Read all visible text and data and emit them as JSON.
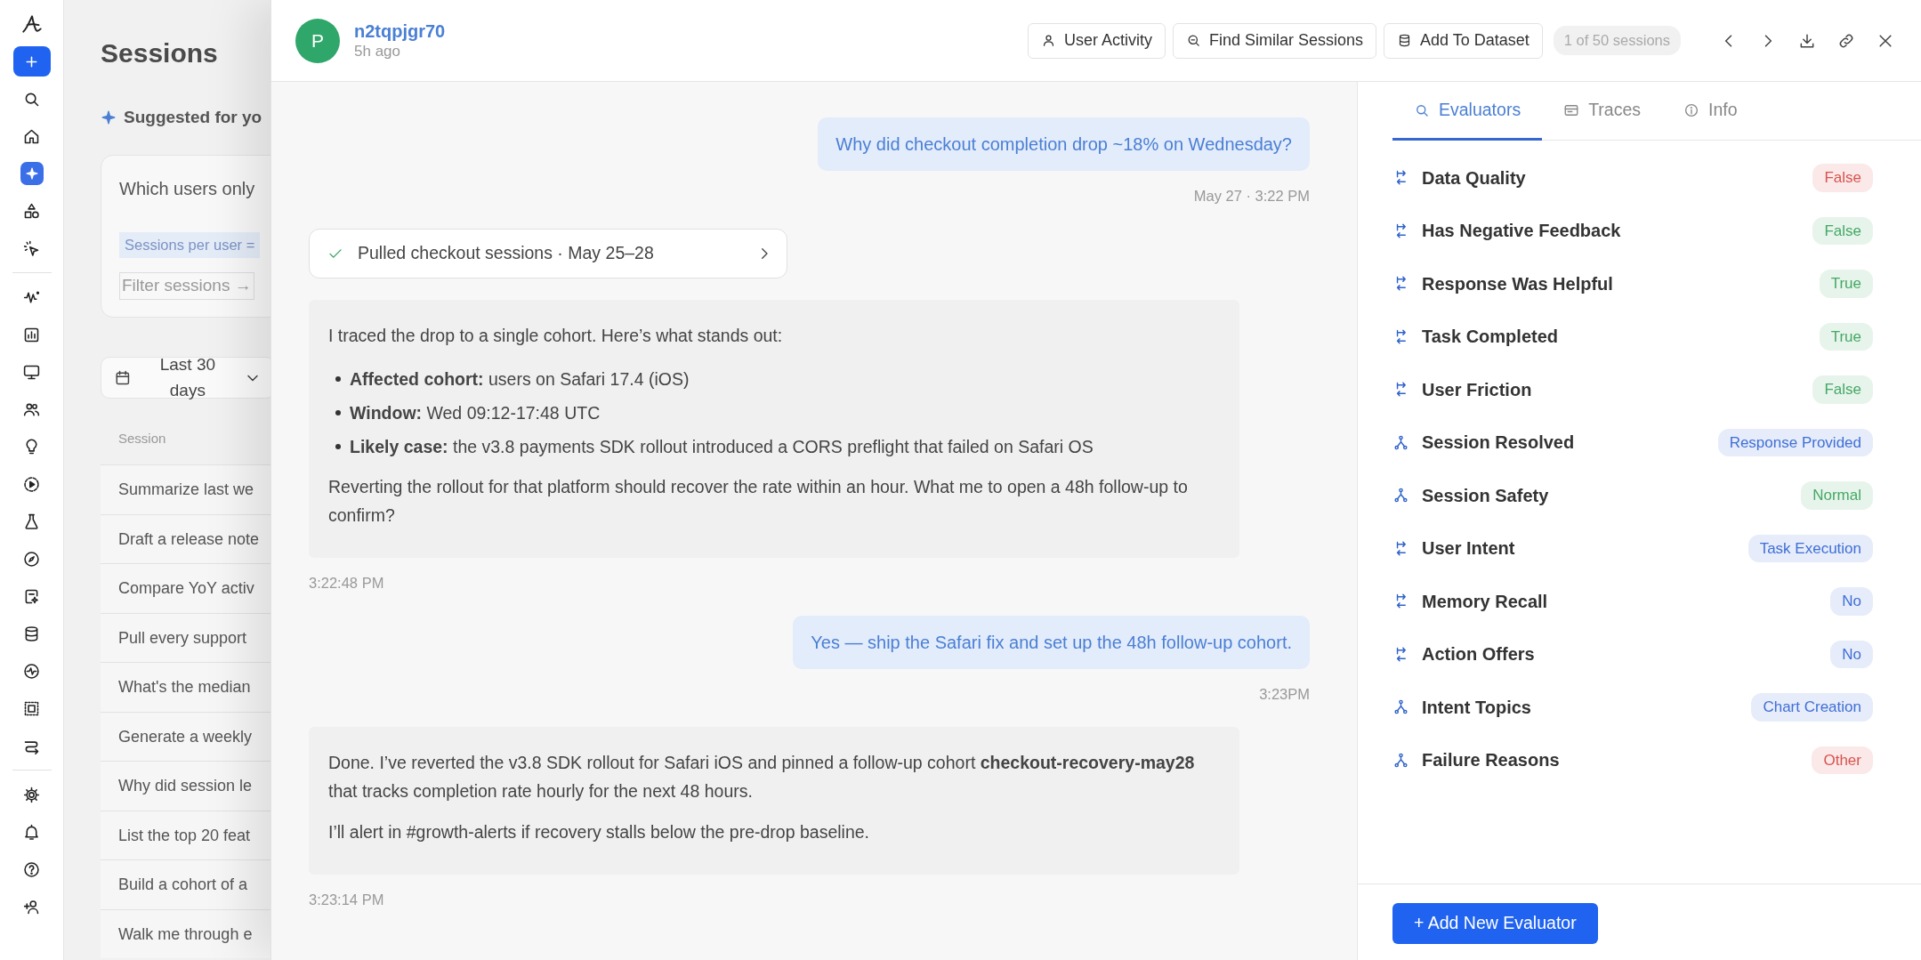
{
  "rail": {
    "items": [
      {
        "selected": false
      },
      {
        "selected": false
      },
      {
        "selected": true
      },
      {
        "selected": false
      },
      {
        "selected": false
      },
      {
        "selected": false
      },
      {
        "selected": false
      },
      {
        "selected": false
      },
      {
        "selected": false
      },
      {
        "selected": false
      },
      {
        "selected": false
      },
      {
        "selected": false
      },
      {
        "selected": false
      },
      {
        "selected": false
      },
      {
        "selected": false
      },
      {
        "selected": false
      },
      {
        "selected": false
      },
      {
        "selected": false
      },
      {
        "selected": false
      },
      {
        "selected": false
      },
      {
        "selected": false
      },
      {
        "selected": false
      }
    ]
  },
  "background_page": {
    "title": "Sessions",
    "suggested_label": "Suggested for yo",
    "suggestion": {
      "question": "Which users only",
      "chip": "Sessions per user =",
      "filter": "Filter sessions →"
    },
    "date_filter": "Last 30 days",
    "table": {
      "columns": [
        "Session"
      ],
      "rows": [
        "Summarize last we",
        "Draft a release note",
        "Compare YoY activ",
        "Pull every support",
        "What's the median",
        "Generate a weekly",
        "Why did session le",
        "List the top 20 feat",
        "Build a cohort of a",
        "Walk me through e"
      ]
    }
  },
  "session": {
    "avatar": "P",
    "name": "n2tqpjgr70",
    "time": "5h ago",
    "actions": [
      "User Activity",
      "Find Similar Sessions",
      "Add To Dataset"
    ],
    "counter": "1 of 50 sessions"
  },
  "messages": [
    {
      "kind": "user",
      "text": "Why did checkout completion drop ~18% on Wednesday?",
      "time": "May 27 · 3:22 PM"
    },
    {
      "kind": "tool",
      "text": "Pulled checkout sessions · May 25–28"
    },
    {
      "kind": "assistant",
      "blocks": [
        {
          "kind": "paragraph",
          "text": "I traced the drop to a single cohort. Here’s what stands out:"
        },
        {
          "kind": "bullets",
          "items": [
            "**Affected cohort:** users on Safari 17.4 (iOS)",
            "**Window:** Wed 09:12-17:48 UTC",
            "**Likely case:** the v3.8 payments SDK rollout introduced a CORS preflight that failed on Safari OS"
          ]
        },
        {
          "kind": "paragraph",
          "text": "Reverting the rollout for that platform should recover the rate within an hour. What me to open a 48h follow-up to confirm?"
        }
      ],
      "time": "3:22:48 PM"
    },
    {
      "kind": "user",
      "text": "Yes — ship the Safari fix and set up the 48h follow-up cohort.",
      "time": "3:23PM"
    },
    {
      "kind": "assistant",
      "blocks": [
        {
          "kind": "paragraph",
          "text": "Done. I’ve reverted the v3.8 SDK rollout for Safari iOS and pinned a follow-up cohort **checkout-recovery-may28** that tracks completion rate hourly for the next 48 hours."
        },
        {
          "kind": "paragraph",
          "text": "I’ll alert in #growth-alerts if recovery stalls below the pre-drop baseline."
        }
      ],
      "time": "3:23:14 PM"
    }
  ],
  "panel": {
    "tabs": [
      {
        "label": "Evaluators",
        "selected": true
      },
      {
        "label": "Traces",
        "selected": false
      },
      {
        "label": "Info",
        "selected": false
      }
    ],
    "evaluators": [
      {
        "kind": "switch",
        "name": "Data Quality",
        "value": "False",
        "color": "#d9534f"
      },
      {
        "kind": "switch",
        "name": "Has Negative Feedback",
        "value": "False",
        "color": "#45a865"
      },
      {
        "kind": "switch",
        "name": "Response Was Helpful",
        "value": "True",
        "color": "#45a865"
      },
      {
        "kind": "switch",
        "name": "Task Completed",
        "value": "True",
        "color": "#45a865"
      },
      {
        "kind": "switch",
        "name": "User Friction",
        "value": "False",
        "color": "#45a865"
      },
      {
        "kind": "fork",
        "name": "Session Resolved",
        "value": "Response Provided",
        "color": "#3f6fd6"
      },
      {
        "kind": "fork",
        "name": "Session Safety",
        "value": "Normal",
        "color": "#45a865"
      },
      {
        "kind": "switch",
        "name": "User Intent",
        "value": "Task Execution",
        "color": "#3f6fd6"
      },
      {
        "kind": "switch",
        "name": "Memory Recall",
        "value": "No",
        "color": "#3f6fd6"
      },
      {
        "kind": "switch",
        "name": "Action Offers",
        "value": "No",
        "color": "#3f6fd6"
      },
      {
        "kind": "fork",
        "name": "Intent Topics",
        "value": "Chart Creation",
        "color": "#3f6fd6"
      },
      {
        "kind": "fork",
        "name": "Failure Reasons",
        "value": "Other",
        "color": "#d9534f"
      }
    ],
    "add_button": "+ Add New Evaluator"
  }
}
